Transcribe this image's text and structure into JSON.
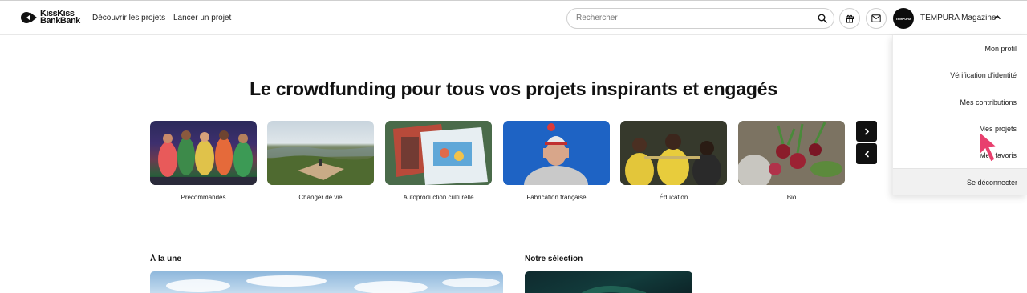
{
  "header": {
    "logo_line1": "KissKiss",
    "logo_line2": "BankBank",
    "nav": [
      "Découvrir les projets",
      "Lancer un projet"
    ],
    "search_placeholder": "Rechercher",
    "avatar_text": "TEMPURA",
    "user_name": "TEMPURA Magazine"
  },
  "hero": {
    "title": "Le crowdfunding pour tous vos projets inspirants et engagés"
  },
  "categories": [
    {
      "label": "Précommandes",
      "icon": "group-photo"
    },
    {
      "label": "Changer de vie",
      "icon": "landscape-photo"
    },
    {
      "label": "Autoproduction culturelle",
      "icon": "board-game-photo"
    },
    {
      "label": "Fabrication française",
      "icon": "beanie-photo"
    },
    {
      "label": "Éducation",
      "icon": "music-class-photo"
    },
    {
      "label": "Bio",
      "icon": "vegetables-photo"
    }
  ],
  "sections": {
    "featured": "À la une",
    "selection": "Notre sélection"
  },
  "dropdown": {
    "items": [
      "Mon profil",
      "Vérification d'identité",
      "Mes contributions",
      "Mes projets",
      "Mes favoris"
    ],
    "logout": "Se déconnecter"
  },
  "colors": {
    "accent": "#111111",
    "cursor": "#e8406e"
  }
}
